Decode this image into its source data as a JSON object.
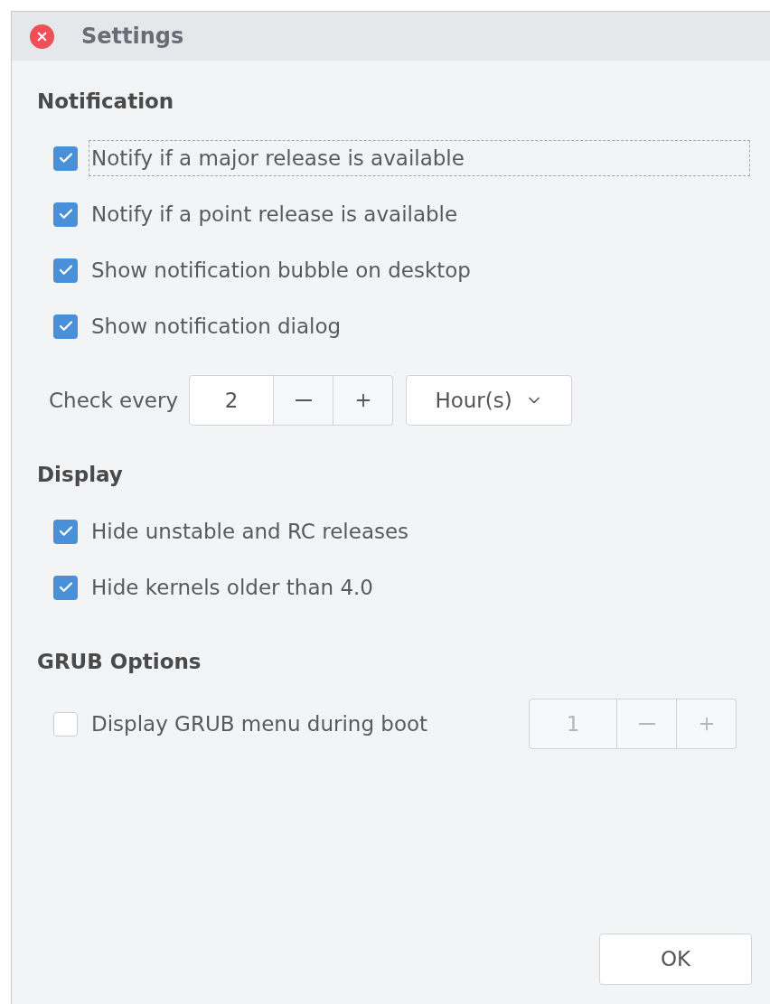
{
  "window": {
    "title": "Settings"
  },
  "sections": [
    {
      "heading": "Notification",
      "items": [
        {
          "kind": "checkbox",
          "label": "Notify if a major release is available",
          "checked": true,
          "focused": true
        },
        {
          "kind": "checkbox",
          "label": "Notify if a point release is available",
          "checked": true,
          "focused": false
        },
        {
          "kind": "checkbox",
          "label": "Show notification bubble on desktop",
          "checked": true,
          "focused": false
        },
        {
          "kind": "checkbox",
          "label": "Show notification dialog",
          "checked": true,
          "focused": false
        },
        {
          "kind": "interval",
          "label": "Check every",
          "value": "2",
          "unit": "Hour(s)",
          "disabled": false
        }
      ]
    },
    {
      "heading": "Display",
      "items": [
        {
          "kind": "checkbox",
          "label": "Hide unstable and RC releases",
          "checked": true,
          "focused": false
        },
        {
          "kind": "checkbox",
          "label": "Hide kernels older than 4.0",
          "checked": true,
          "focused": false
        }
      ]
    },
    {
      "heading": "GRUB Options",
      "items": [
        {
          "kind": "checkbox_spin",
          "label": "Display GRUB menu during boot",
          "checked": false,
          "focused": false,
          "value": "1",
          "disabled": true
        }
      ]
    }
  ],
  "buttons": [
    "OK"
  ]
}
